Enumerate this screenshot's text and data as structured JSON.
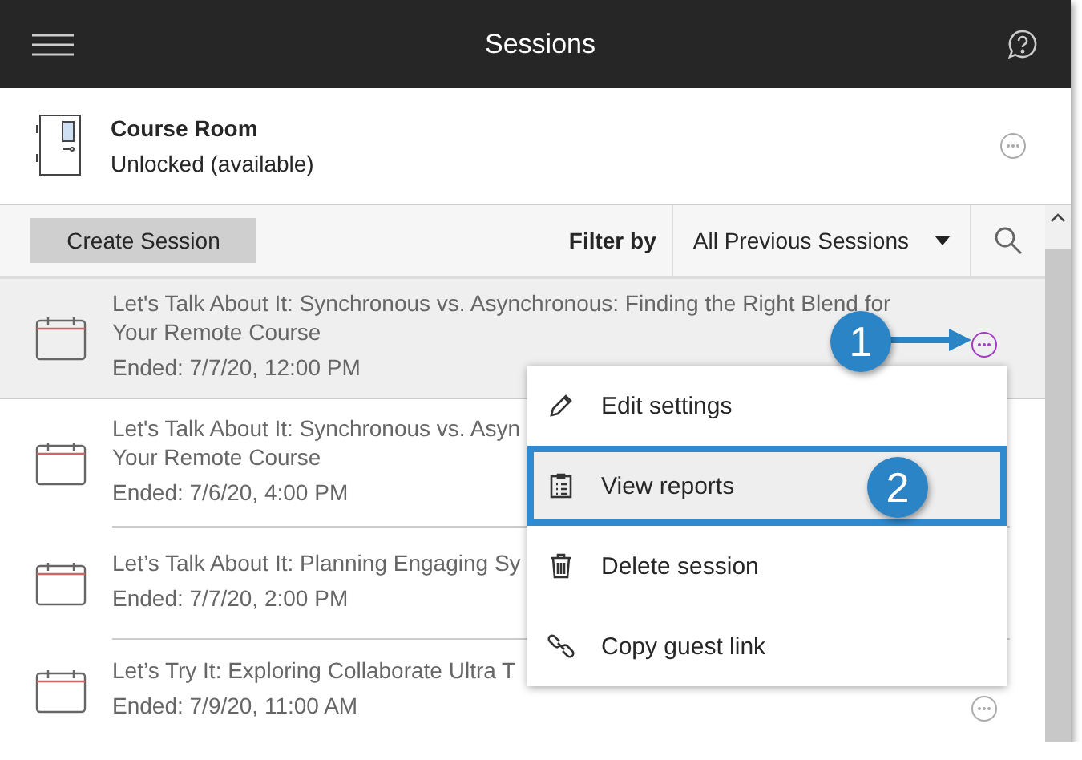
{
  "header": {
    "title": "Sessions"
  },
  "course_room": {
    "name": "Course Room",
    "status": "Unlocked (available)"
  },
  "toolbar": {
    "create_button": "Create Session",
    "filter_label": "Filter by",
    "filter_value": "All Previous Sessions"
  },
  "sessions": [
    {
      "title_lines": [
        "Let's Talk About It: Synchronous vs. Asynchronous: Finding the Right Blend for",
        "Your Remote Course"
      ],
      "ended": "Ended: 7/7/20, 12:00 PM",
      "selected": true,
      "actions_visible": true
    },
    {
      "title_lines": [
        "Let's Talk About It: Synchronous vs. Asyn",
        "Your Remote Course"
      ],
      "ended": "Ended: 7/6/20, 4:00 PM",
      "selected": false,
      "actions_visible": false
    },
    {
      "title_lines": [
        "Let’s Talk About It: Planning Engaging Sy"
      ],
      "ended": "Ended: 7/7/20, 2:00 PM",
      "selected": false,
      "actions_visible": false
    },
    {
      "title_lines": [
        "Let’s Try It: Exploring Collaborate Ultra T"
      ],
      "ended": "Ended: 7/9/20, 11:00 AM",
      "selected": false,
      "actions_visible": true
    }
  ],
  "menu": [
    {
      "kind": "edit",
      "label": "Edit settings",
      "highlighted": false
    },
    {
      "kind": "reports",
      "label": "View reports",
      "highlighted": true
    },
    {
      "kind": "delete",
      "label": "Delete session",
      "highlighted": false
    },
    {
      "kind": "link",
      "label": "Copy guest link",
      "highlighted": false
    }
  ],
  "callouts": [
    {
      "label": "1"
    },
    {
      "label": "2"
    }
  ]
}
